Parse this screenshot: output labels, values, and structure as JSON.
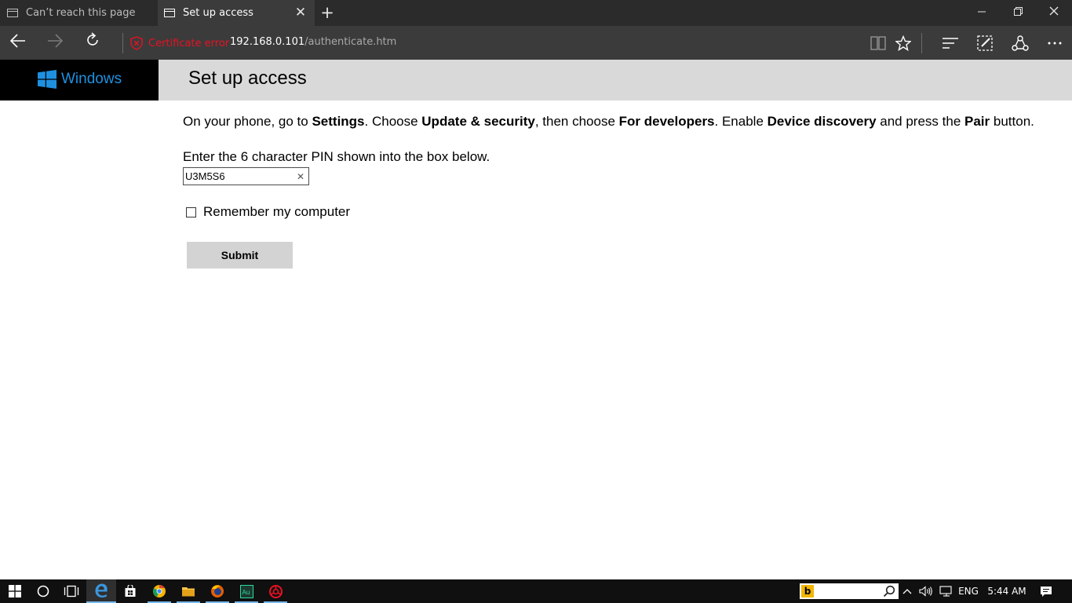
{
  "browser": {
    "tabs": [
      {
        "title": "Can’t reach this page",
        "active": false
      },
      {
        "title": "Set up access",
        "active": true
      }
    ],
    "new_tab_icon": "plus-icon",
    "window_controls": [
      "minimize-icon",
      "restore-icon",
      "close-icon"
    ],
    "address": {
      "cert_label": "Certificate error",
      "url_host": "192.168.0.101",
      "url_path": "/authenticate.htm"
    },
    "toolbar_icons": [
      "reading-view-icon",
      "favorite-star-icon",
      "hub-icon",
      "web-note-icon",
      "share-icon",
      "more-icon"
    ]
  },
  "page": {
    "logo_text": "Windows",
    "title": "Set up access",
    "instructions": {
      "p1": "On your phone, go to ",
      "b1": "Settings",
      "p2": ". Choose ",
      "b2": "Update & security",
      "p3": ", then choose ",
      "b3": "For developers",
      "p4": ". Enable ",
      "b4": "Device discovery",
      "p5": " and press the ",
      "b5": "Pair",
      "p6": " button."
    },
    "pin_label": "Enter the 6 character PIN shown into the box below.",
    "pin_value": "U3M5S6",
    "remember_label": "Remember my computer",
    "remember_checked": false,
    "submit_label": "Submit"
  },
  "taskbar": {
    "apps": [
      "windows-start-icon",
      "cortana-icon",
      "task-view-icon",
      "edge-icon",
      "store-icon",
      "chrome-canary-icon",
      "file-explorer-icon",
      "firefox-icon",
      "audition-icon",
      "app-red-icon"
    ],
    "language": "ENG",
    "time": "5:44 AM"
  },
  "colors": {
    "cert_error": "#e81123",
    "windows_blue": "#1e90e0",
    "header_gray": "#d9d9d9",
    "button_gray": "#d3d3d3"
  }
}
